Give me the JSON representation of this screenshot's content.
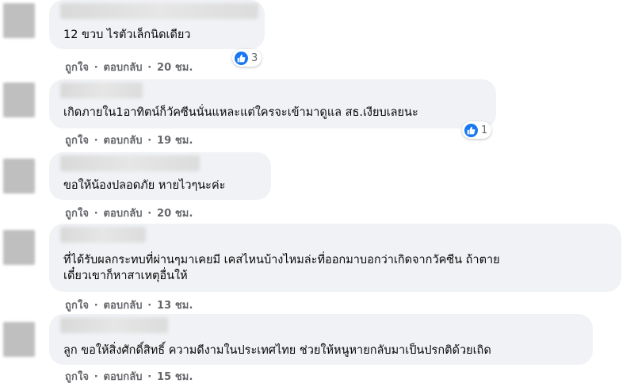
{
  "colors": {
    "bubble_bg": "#f0f2f5",
    "meta_text": "#65676b",
    "like_blue": "#1877f2"
  },
  "comments": [
    {
      "text": "12 ขวบ ไรตัวเล็กนิดเดียว",
      "like_label": "ถูกใจ",
      "reply_label": "ตอบกลับ",
      "time": "20 ชม.",
      "reaction_icon": "like-icon",
      "reaction_count": "3"
    },
    {
      "text": "เกิดภายใน1อาทิตน์ก็วัคซีนนั่นแหละแต่ใครจะเข้ามาดูแล สธ.เงียบเลยนะ",
      "like_label": "ถูกใจ",
      "reply_label": "ตอบกลับ",
      "time": "19 ชม.",
      "reaction_icon": "like-icon",
      "reaction_count": "1"
    },
    {
      "text": "ขอให้น้องปลอดภัย หายไวๆนะค่ะ",
      "like_label": "ถูกใจ",
      "reply_label": "ตอบกลับ",
      "time": "20 ชม."
    },
    {
      "text": "ที่ได้รับผลกระทบที่ผ่านๆมาเคยมี เคสไหนบ้างไหมล่ะที่ออกมาบอกว่าเกิดจากวัคซีน ถ้าตาย\nเดี๋ยวเขาก็หาสาเหตุอื่นให้",
      "like_label": "ถูกใจ",
      "reply_label": "ตอบกลับ",
      "time": "13 ชม."
    },
    {
      "text": "ลูก ขอให้สิ่งศักดิ์สิทธิ์ ความดีงามในประเทศไทย ช่วยให้หนูหายกลับมาเป็นปรกติด้วยเถิด",
      "like_label": "ถูกใจ",
      "reply_label": "ตอบกลับ",
      "time": "15 ชม."
    }
  ]
}
